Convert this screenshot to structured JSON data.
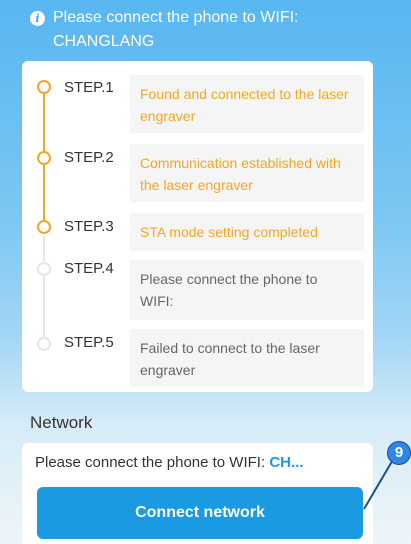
{
  "banner": {
    "icon": "info-icon",
    "message": "Please connect the phone to WIFI: CHANGLANG"
  },
  "steps": [
    {
      "label": "STEP.1",
      "text": "Found and connected to the laser engraver",
      "status": "done"
    },
    {
      "label": "STEP.2",
      "text": "Communication established with the laser engraver",
      "status": "done"
    },
    {
      "label": "STEP.3",
      "text": "STA mode setting completed",
      "status": "done"
    },
    {
      "label": "STEP.4",
      "text": "Please connect the phone to WIFI:",
      "status": "pending"
    },
    {
      "label": "STEP.5",
      "text": "Failed to connect to the laser engraver",
      "status": "pending"
    }
  ],
  "network": {
    "title": "Network",
    "prompt": "Please connect the phone to WIFI:",
    "ssid_truncated": "CH...",
    "button_label": "Connect network"
  },
  "annotation": {
    "badge": "9"
  },
  "colors": {
    "done": "#f5a623",
    "pending": "#e6e6e6",
    "accent": "#1a9ae0",
    "ssid": "#2196f3"
  }
}
